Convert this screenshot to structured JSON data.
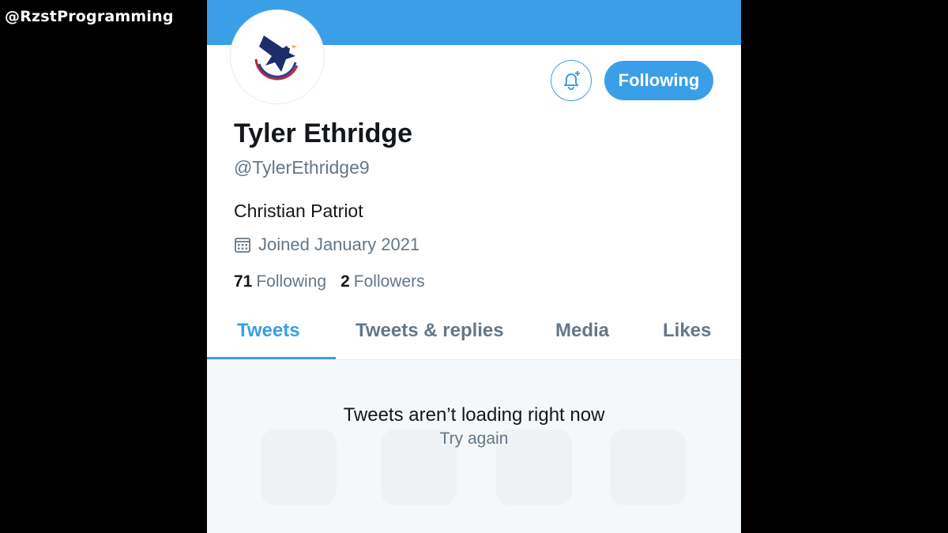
{
  "watermark": "@RzstProgramming",
  "profile": {
    "name": "Tyler Ethridge",
    "handle": "@TylerEthridge9",
    "bio": "Christian Patriot",
    "joined": "Joined January 2021",
    "following_count": "71",
    "following_label": "Following",
    "followers_count": "2",
    "followers_label": "Followers"
  },
  "actions": {
    "follow_button": "Following",
    "notify_icon": "bell-plus-icon"
  },
  "tabs": [
    {
      "label": "Tweets",
      "active": true
    },
    {
      "label": "Tweets & replies",
      "active": false
    },
    {
      "label": "Media",
      "active": false
    },
    {
      "label": "Likes",
      "active": false
    }
  ],
  "feed": {
    "error_title": "Tweets aren’t loading right now",
    "retry": "Try again"
  },
  "colors": {
    "accent": "#3a9fe6",
    "text_primary": "#14171a",
    "text_secondary": "#657786"
  }
}
